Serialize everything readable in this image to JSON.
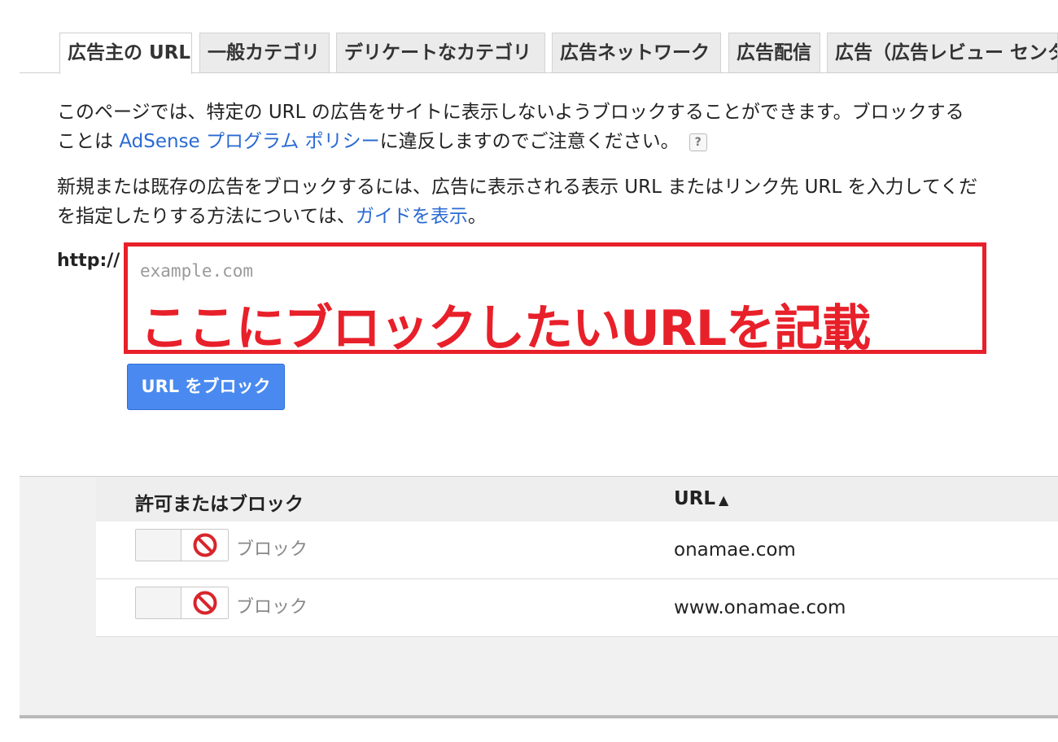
{
  "tabs": [
    {
      "label": "広告主の URL",
      "active": true
    },
    {
      "label": "一般カテゴリ",
      "active": false
    },
    {
      "label": "デリケートなカテゴリ",
      "active": false
    },
    {
      "label": "広告ネットワーク",
      "active": false
    },
    {
      "label": "広告配信",
      "active": false
    },
    {
      "label": "広告（広告レビュー センタ",
      "active": false
    }
  ],
  "intro": {
    "line1": "このページでは、特定の URL の広告をサイトに表示しないようブロックすることができます。ブロックする",
    "line2_prefix": "ことは ",
    "line2_link": "AdSense プログラム ポリシー",
    "line2_suffix": "に違反しますのでご注意ください。",
    "help_icon": "?"
  },
  "instructions": {
    "line1": "新規または既存の広告をブロックするには、広告に表示される表示 URL またはリンク先 URL を入力してくだ",
    "line2_prefix": "を指定したりする方法については、",
    "line2_link": "ガイドを表示",
    "line2_suffix": "。"
  },
  "url_form": {
    "prefix": "http://",
    "placeholder": "example.com",
    "annotation": "ここにブロックしたいURLを記載",
    "annotation_color": "#e8202a",
    "submit_label": "URL をブロック"
  },
  "table": {
    "columns": [
      "許可またはブロック",
      "URL"
    ],
    "sort_indicator": "🡑",
    "rows": [
      {
        "status": "ブロック",
        "status_icon": "ban-icon",
        "url": "onamae.com"
      },
      {
        "status": "ブロック",
        "status_icon": "ban-icon",
        "url": "www.onamae.com"
      }
    ]
  },
  "colors": {
    "link": "#2a6ad3",
    "button": "#4a8af0",
    "ban": "#d8252b"
  }
}
